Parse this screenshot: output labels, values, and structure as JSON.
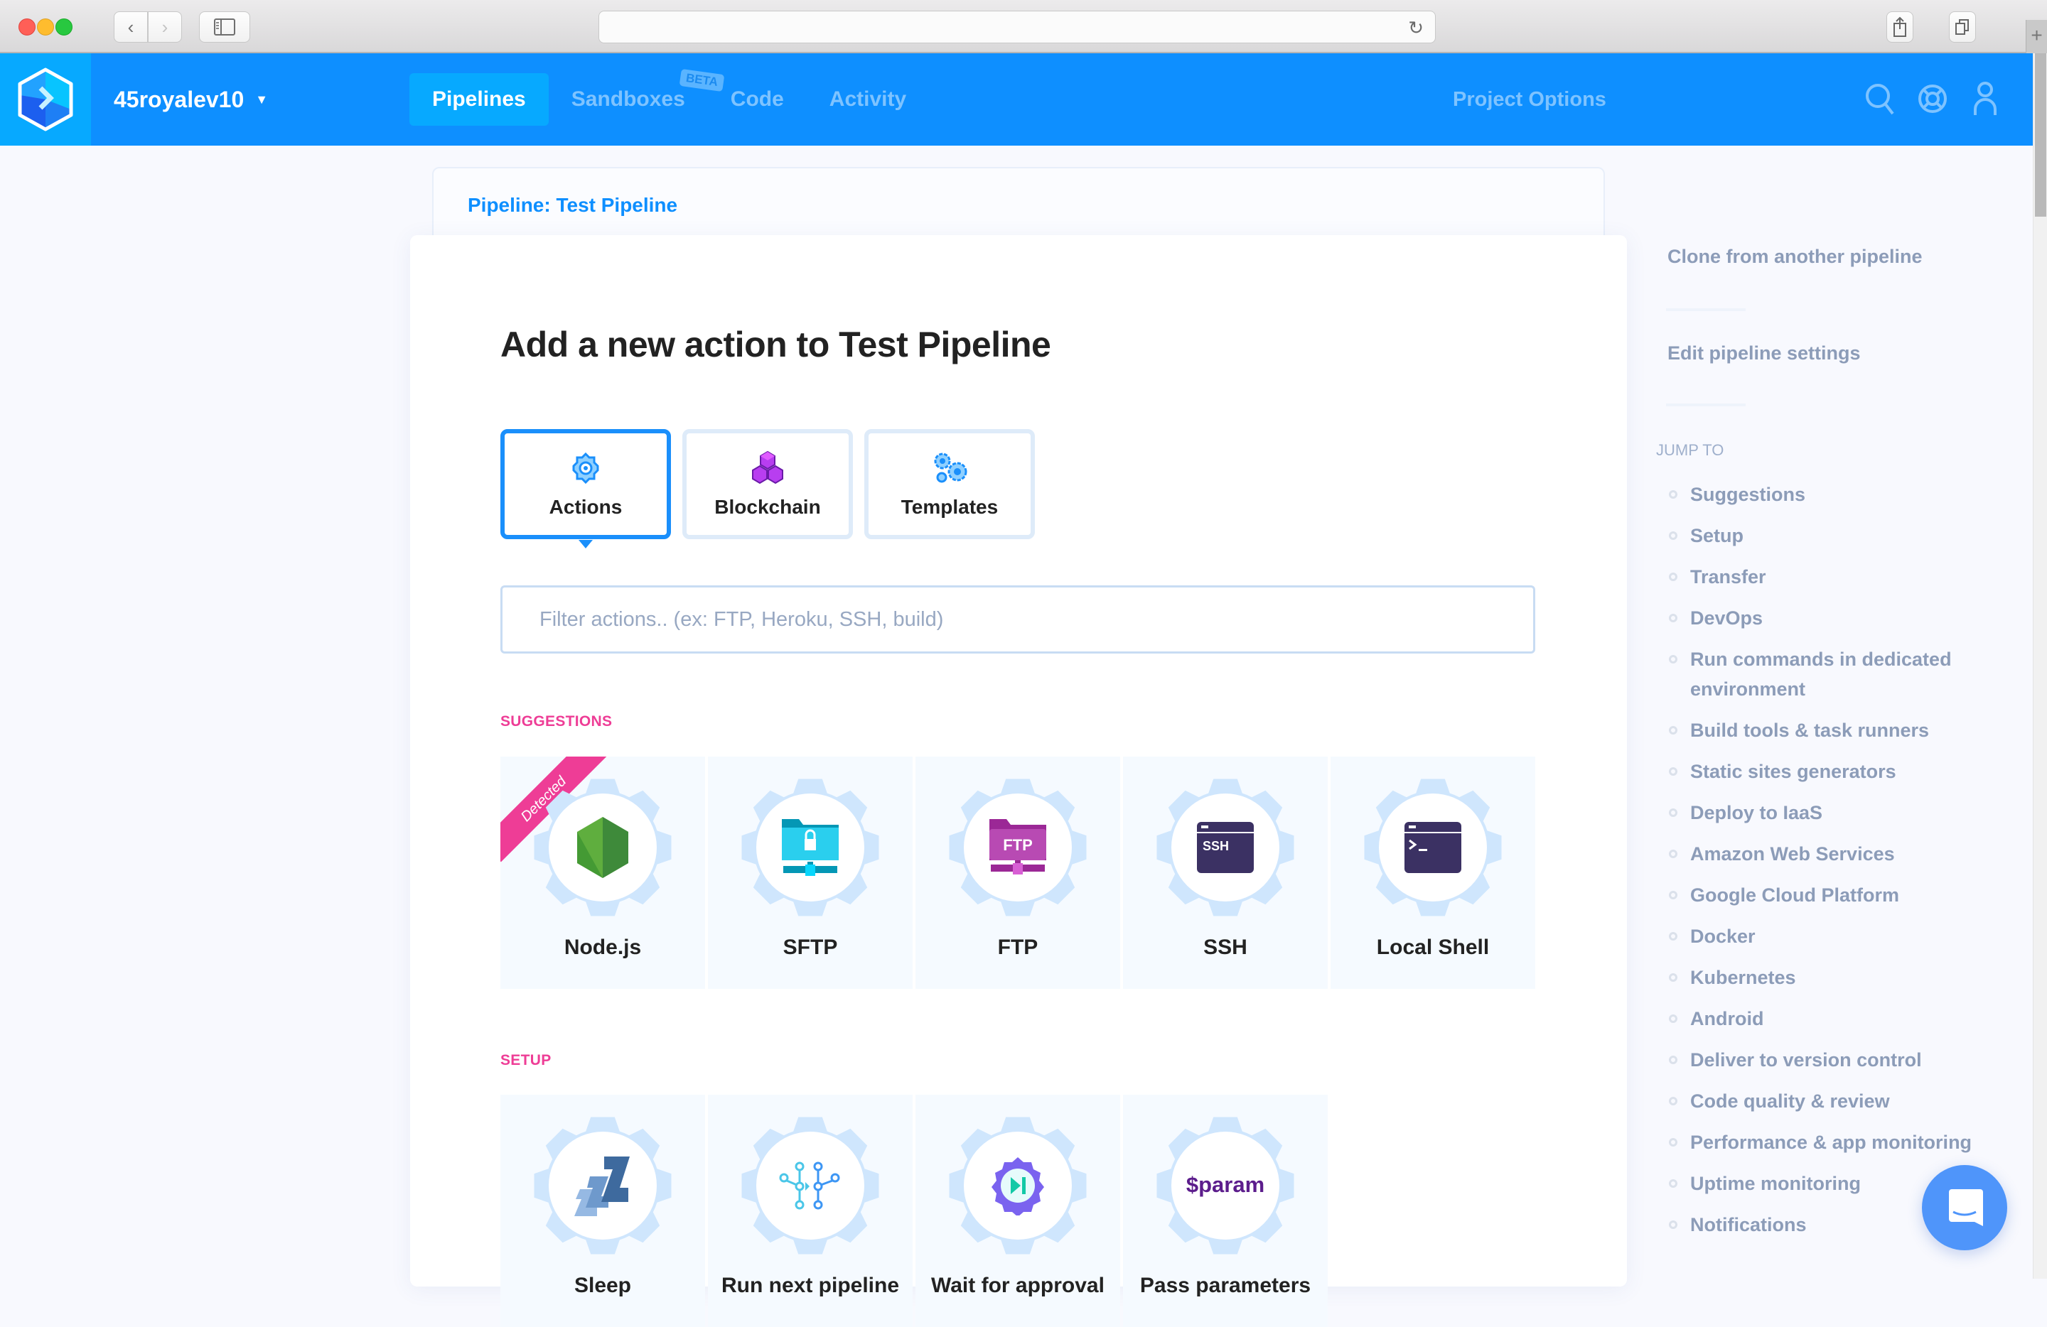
{
  "browser": {
    "address": "",
    "buttons": {
      "back": "back-icon",
      "forward": "forward-icon",
      "sidebar": "sidebar-icon",
      "reload": "reload-icon",
      "share": "share-icon",
      "tabs": "tabs-icon",
      "new_tab": "+"
    }
  },
  "header": {
    "project_name": "45royalev10",
    "nav": [
      {
        "label": "Pipelines",
        "active": true
      },
      {
        "label": "Sandboxes",
        "badge": "BETA"
      },
      {
        "label": "Code"
      },
      {
        "label": "Activity"
      }
    ],
    "project_options": "Project Options",
    "icons": [
      "search-icon",
      "help-icon",
      "user-icon"
    ]
  },
  "breadcrumb": "Pipeline: Test Pipeline",
  "main": {
    "title": "Add a new action to Test Pipeline",
    "tabs": [
      {
        "label": "Actions",
        "icon": "gear-icon",
        "active": true
      },
      {
        "label": "Blockchain",
        "icon": "blockchain-icon"
      },
      {
        "label": "Templates",
        "icon": "gears-icon"
      }
    ],
    "filter": {
      "value": "",
      "placeholder": "Filter actions.. (ex: FTP, Heroku, SSH, build)"
    },
    "sections": [
      {
        "label": "SUGGESTIONS",
        "items": [
          {
            "name": "Node.js",
            "icon": "nodejs-icon",
            "ribbon": "Detected"
          },
          {
            "name": "SFTP",
            "icon": "sftp-icon"
          },
          {
            "name": "FTP",
            "icon": "ftp-icon",
            "icon_text": "FTP"
          },
          {
            "name": "SSH",
            "icon": "ssh-icon",
            "icon_text": "SSH"
          },
          {
            "name": "Local Shell",
            "icon": "terminal-icon",
            "icon_text": ">_"
          }
        ]
      },
      {
        "label": "SETUP",
        "items": [
          {
            "name": "Sleep",
            "icon": "sleep-icon"
          },
          {
            "name": "Run next pipeline",
            "icon": "pipeline-icon"
          },
          {
            "name": "Wait for approval",
            "icon": "approval-icon"
          },
          {
            "name": "Pass parameters",
            "icon": "param-icon",
            "icon_text": "$param"
          }
        ]
      }
    ]
  },
  "sidebar": {
    "links": [
      "Clone from another pipeline",
      "Edit pipeline settings"
    ],
    "jump_title": "JUMP TO",
    "jump_items": [
      "Suggestions",
      "Setup",
      "Transfer",
      "DevOps",
      "Run commands in dedicated environment",
      "Build tools & task runners",
      "Static sites generators",
      "Deploy to IaaS",
      "Amazon Web Services",
      "Google Cloud Platform",
      "Docker",
      "Kubernetes",
      "Android",
      "Deliver to version control",
      "Code quality & review",
      "Performance & app monitoring",
      "Uptime monitoring",
      "Notifications"
    ]
  },
  "colors": {
    "brand": "#0e8fff",
    "brand_light": "#07a9ff",
    "accent_pink": "#ee3d96",
    "muted_text": "#8c9cb8"
  }
}
